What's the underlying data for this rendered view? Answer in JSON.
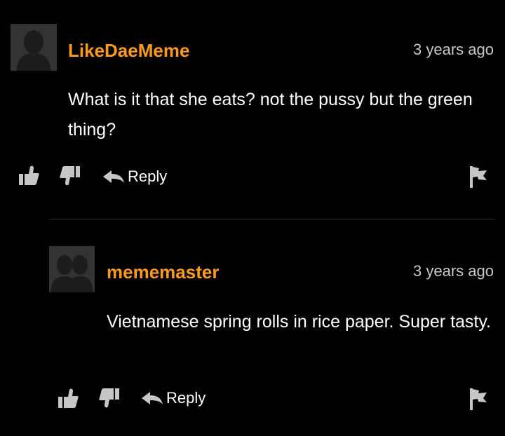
{
  "colors": {
    "background": "#000000",
    "username": "#ff9a1f",
    "timestamp": "#c8c8c8",
    "text": "#ffffff",
    "icon": "#c6c6c6",
    "avatar": "#333333"
  },
  "comments": [
    {
      "username": "LikeDaeMeme",
      "timestamp": "3 years ago",
      "text": "What is it that she eats? not the pussy but the green thing?",
      "avatar_icon": "single-person-silhouette-icon",
      "actions": {
        "thumbs_up_icon": "thumbs-up-icon",
        "thumbs_down_icon": "thumbs-down-icon",
        "reply_icon": "reply-arrow-icon",
        "reply_label": "Reply",
        "flag_icon": "flag-icon"
      }
    },
    {
      "username": "mememaster",
      "timestamp": "3 years ago",
      "text": "Vietnamese spring rolls in rice paper. Super tasty.",
      "avatar_icon": "group-silhouette-icon",
      "actions": {
        "thumbs_up_icon": "thumbs-up-icon",
        "thumbs_down_icon": "thumbs-down-icon",
        "reply_icon": "reply-arrow-icon",
        "reply_label": "Reply",
        "flag_icon": "flag-icon"
      }
    }
  ]
}
